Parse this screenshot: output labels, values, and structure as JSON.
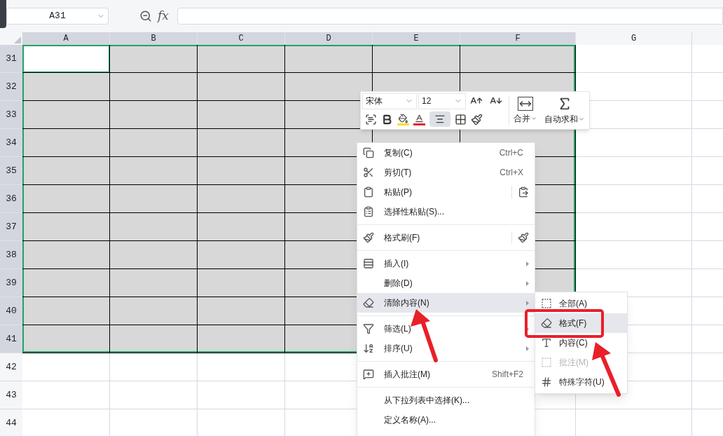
{
  "name_box": {
    "value": "A31"
  },
  "formula_bar": {
    "label": "fx"
  },
  "columns": [
    {
      "label": "A",
      "selected": true,
      "active": true
    },
    {
      "label": "B",
      "selected": true,
      "active": false
    },
    {
      "label": "C",
      "selected": true,
      "active": false
    },
    {
      "label": "D",
      "selected": true,
      "active": false
    },
    {
      "label": "E",
      "selected": true,
      "active": false
    },
    {
      "label": "F",
      "selected": true,
      "active": false
    },
    {
      "label": "G",
      "selected": false,
      "active": false
    }
  ],
  "rows": [
    {
      "label": "31",
      "selected": true,
      "active": true
    },
    {
      "label": "32",
      "selected": true,
      "active": false
    },
    {
      "label": "33",
      "selected": true,
      "active": false
    },
    {
      "label": "34",
      "selected": true,
      "active": false
    },
    {
      "label": "35",
      "selected": true,
      "active": false
    },
    {
      "label": "36",
      "selected": true,
      "active": false
    },
    {
      "label": "37",
      "selected": true,
      "active": false
    },
    {
      "label": "38",
      "selected": true,
      "active": false
    },
    {
      "label": "39",
      "selected": true,
      "active": false
    },
    {
      "label": "40",
      "selected": true,
      "active": false
    },
    {
      "label": "41",
      "selected": true,
      "active": false
    },
    {
      "label": "42",
      "selected": false,
      "active": false
    },
    {
      "label": "43",
      "selected": false,
      "active": false
    },
    {
      "label": "44",
      "selected": false,
      "active": false
    }
  ],
  "mini_toolbar": {
    "font": "宋体",
    "size": "12",
    "align_pressed": true,
    "merge_label": "合并",
    "autosum_label": "自动求和"
  },
  "context_menu": [
    {
      "kind": "item",
      "label": "复制(C)",
      "shortcut": "Ctrl+C",
      "submenu": false,
      "selected": false
    },
    {
      "kind": "item",
      "label": "剪切(T)",
      "shortcut": "Ctrl+X",
      "submenu": false,
      "selected": false
    },
    {
      "kind": "item",
      "label": "粘贴(P)",
      "submenu": false,
      "selected": false
    },
    {
      "kind": "item",
      "label": "选择性粘贴(S)...",
      "submenu": false,
      "selected": false
    },
    {
      "kind": "separator"
    },
    {
      "kind": "item",
      "label": "格式刷(F)",
      "submenu": false,
      "selected": false
    },
    {
      "kind": "separator"
    },
    {
      "kind": "item",
      "label": "插入(I)",
      "submenu": true,
      "selected": false
    },
    {
      "kind": "item",
      "label": "删除(D)",
      "submenu": true,
      "selected": false
    },
    {
      "kind": "item",
      "label": "清除内容(N)",
      "submenu": true,
      "selected": true
    },
    {
      "kind": "separator"
    },
    {
      "kind": "item",
      "label": "筛选(L)",
      "submenu": true,
      "selected": false
    },
    {
      "kind": "item",
      "label": "排序(U)",
      "submenu": true,
      "selected": false
    },
    {
      "kind": "separator"
    },
    {
      "kind": "item",
      "label": "插入批注(M)",
      "shortcut": "Shift+F2",
      "submenu": false,
      "selected": false
    },
    {
      "kind": "separator"
    },
    {
      "kind": "item",
      "label": "从下拉列表中选择(K)...",
      "submenu": false,
      "selected": false
    },
    {
      "kind": "item",
      "label": "定义名称(A)...",
      "submenu": false,
      "selected": false
    }
  ],
  "submenu": [
    {
      "label": "全部(A)",
      "selected": false,
      "disabled": false
    },
    {
      "label": "格式(F)",
      "selected": true,
      "disabled": false
    },
    {
      "label": "内容(C)",
      "selected": false,
      "disabled": false
    },
    {
      "label": "批注(M)",
      "selected": false,
      "disabled": true
    },
    {
      "label": "特殊字符(U)",
      "selected": false,
      "disabled": false
    }
  ]
}
